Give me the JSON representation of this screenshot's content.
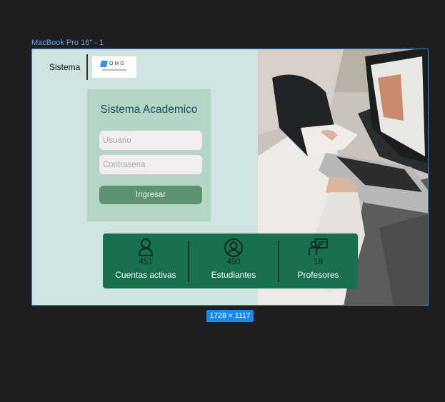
{
  "editor": {
    "frame_label": "MacBook Pro 16\" - 1",
    "size_badge": "1728 × 1117",
    "accent": "#2b8de6"
  },
  "header": {
    "brand": "Sistema",
    "logo_text": "OMG"
  },
  "login": {
    "title": "Sistema Academico",
    "username_placeholder": "Usuario",
    "password_placeholder": "Contrasena",
    "submit_label": "Ingresar"
  },
  "stats": {
    "items": [
      {
        "icon": "user-icon",
        "value": "451",
        "label": "Cuentas activas"
      },
      {
        "icon": "student-icon",
        "value": "450",
        "label": "Estudiantes"
      },
      {
        "icon": "teacher-icon",
        "value": "18",
        "label": "Profesores"
      }
    ]
  },
  "colors": {
    "background_panel": "#cfe3e0",
    "card": "#b5d6c6",
    "button": "#5e9273",
    "stats_bar": "#18704f"
  }
}
